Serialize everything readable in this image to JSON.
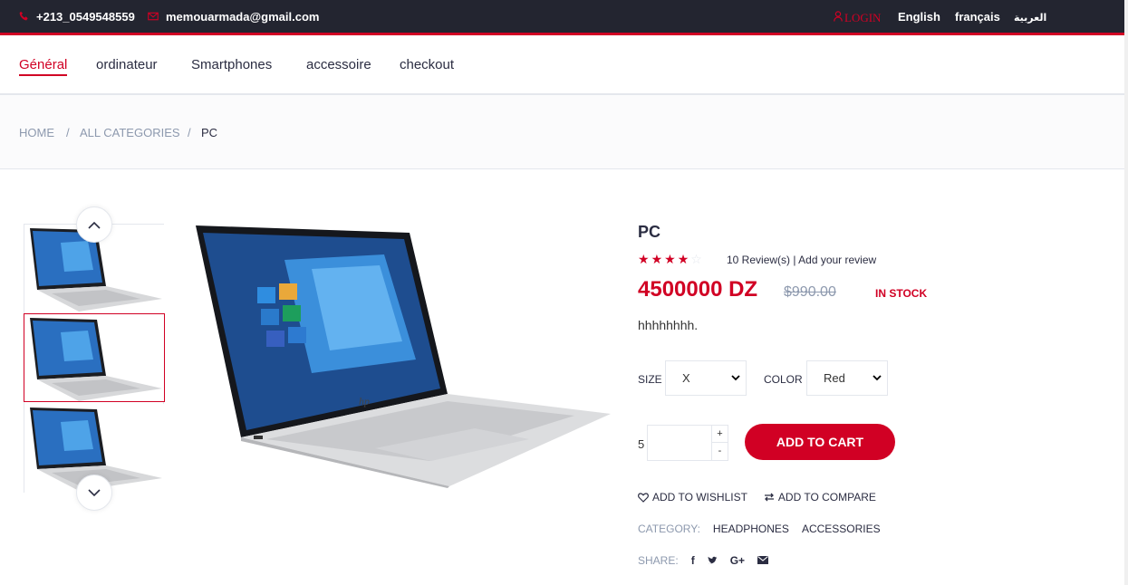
{
  "topbar": {
    "phone": "+213_0549548559",
    "email": "memouarmada@gmail.com",
    "login": "LOGIN",
    "languages": [
      "English",
      "français",
      "العربية"
    ]
  },
  "nav": {
    "items": [
      "Général",
      "ordinateur",
      "Smartphones",
      "accessoire",
      "checkout"
    ],
    "active": "Général"
  },
  "breadcrumb": {
    "items": [
      "HOME",
      "ALL CATEGORIES",
      "PC"
    ],
    "separator": "/"
  },
  "product": {
    "title": "PC",
    "rating": 4,
    "rating_max": 5,
    "reviews_text": "10 Review(s) | Add your review",
    "price": "4500000 DZ",
    "old_price": "$990.00",
    "stock": "IN STOCK",
    "description": "hhhhhhhh.",
    "size_label": "SIZE",
    "size_value": "X",
    "color_label": "COLOR",
    "color_value": "Red",
    "qty_label": "5",
    "qty_value": "",
    "add_to_cart": "ADD TO CART",
    "wishlist": "ADD TO WISHLIST",
    "compare": "ADD TO COMPARE",
    "category_label": "CATEGORY:",
    "categories": [
      "HEADPHONES",
      "ACCESSORIES"
    ],
    "share_label": "SHARE:",
    "share_icons": [
      "facebook-icon",
      "twitter-icon",
      "google-plus-icon",
      "envelope-icon"
    ]
  },
  "colors": {
    "accent": "#d10024",
    "topbar_bg": "#232530",
    "text_dark": "#2b2d42",
    "text_muted": "#8d99ae"
  }
}
